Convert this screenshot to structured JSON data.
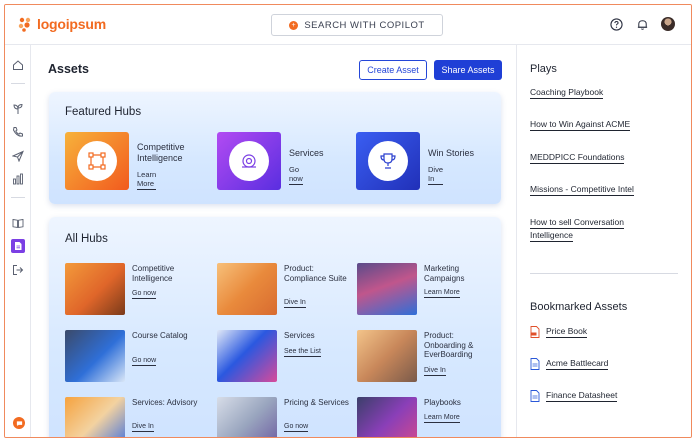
{
  "header": {
    "brand": "logoipsum",
    "search_label": "SEARCH WITH COPILOT",
    "icons": [
      "help-icon",
      "bell-icon",
      "avatar"
    ]
  },
  "rail": {
    "icons": [
      "home-icon",
      "plant-icon",
      "phone-icon",
      "send-icon",
      "chart-icon",
      "book-icon",
      "assets-icon",
      "logout-icon",
      "chat-icon"
    ]
  },
  "main": {
    "title": "Assets",
    "create_label": "Create Asset",
    "share_label": "Share Assets",
    "featured": {
      "title": "Featured Hubs",
      "items": [
        {
          "name": "Competitive Intelligence",
          "link": "Learn More"
        },
        {
          "name": "Services",
          "link": "Go now"
        },
        {
          "name": "Win Stories",
          "link": "Dive In"
        }
      ]
    },
    "all": {
      "title": "All Hubs",
      "items": [
        {
          "name": "Competitive Intelligence",
          "link": "Go now"
        },
        {
          "name": "Product: Compliance Suite",
          "link": "Dive In"
        },
        {
          "name": "Marketing Campaigns",
          "link": "Learn More"
        },
        {
          "name": "Course Catalog",
          "link": "Go now"
        },
        {
          "name": "Services",
          "link": "See the List"
        },
        {
          "name": "Product: Onboarding & EverBoarding",
          "link": "Dive In"
        },
        {
          "name": "Services: Advisory",
          "link": "Dive In"
        },
        {
          "name": "Pricing & Services",
          "link": "Go now"
        },
        {
          "name": "Playbooks",
          "link": "Learn More"
        }
      ]
    }
  },
  "right": {
    "plays_title": "Plays",
    "plays": [
      "Coaching Playbook",
      "How to Win Against ACME",
      "MEDDPICC Foundations",
      "Missions - Competitive Intel",
      "How to sell Conversation Intelligence"
    ],
    "bookmarks_title": "Bookmarked Assets",
    "bookmarks": [
      {
        "label": "Price Book",
        "icon": "pdf-icon"
      },
      {
        "label": "Acme Battlecard",
        "icon": "doc-icon"
      },
      {
        "label": "Finance Datasheet",
        "icon": "doc-icon"
      }
    ]
  },
  "colors": {
    "accent": "#f26b21",
    "primary": "#1f3fd6",
    "purple": "#7b3fe4"
  }
}
